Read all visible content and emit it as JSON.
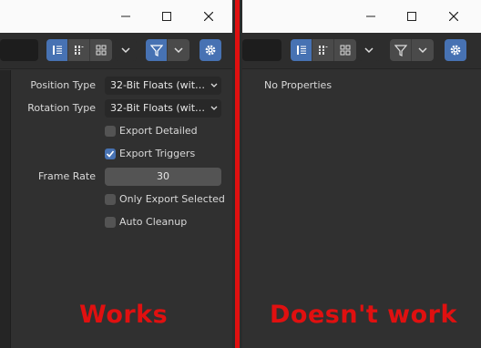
{
  "window_controls": {
    "minimize_label": "—",
    "maximize_label": "☐",
    "close_label": "✕"
  },
  "panel_left": {
    "properties": [
      {
        "label": "Position Type",
        "value": "32-Bit Floats (with D..."
      },
      {
        "label": "Rotation Type",
        "value": "32-Bit Floats (with D..."
      }
    ],
    "checkboxes": {
      "export_detailed": {
        "label": "Export Detailed",
        "checked": false
      },
      "export_triggers": {
        "label": "Export Triggers",
        "checked": true
      },
      "only_export_selected": {
        "label": "Only Export Selected",
        "checked": false
      },
      "auto_cleanup": {
        "label": "Auto Cleanup",
        "checked": false
      }
    },
    "frame_rate": {
      "label": "Frame Rate",
      "value": "30"
    },
    "caption": "Works"
  },
  "panel_right": {
    "status": "No Properties",
    "caption": "Doesn't work"
  },
  "colors": {
    "accent": "#4772b3",
    "caption_red": "#e01010",
    "panel_bg": "#303030",
    "titlebar_bg": "#fafafa"
  },
  "icons": [
    "minimize-icon",
    "maximize-icon",
    "close-icon",
    "list-view-icon",
    "tree-view-icon",
    "grid-view-icon",
    "chevron-down-icon",
    "filter-icon",
    "gear-icon",
    "checkmark-icon"
  ]
}
